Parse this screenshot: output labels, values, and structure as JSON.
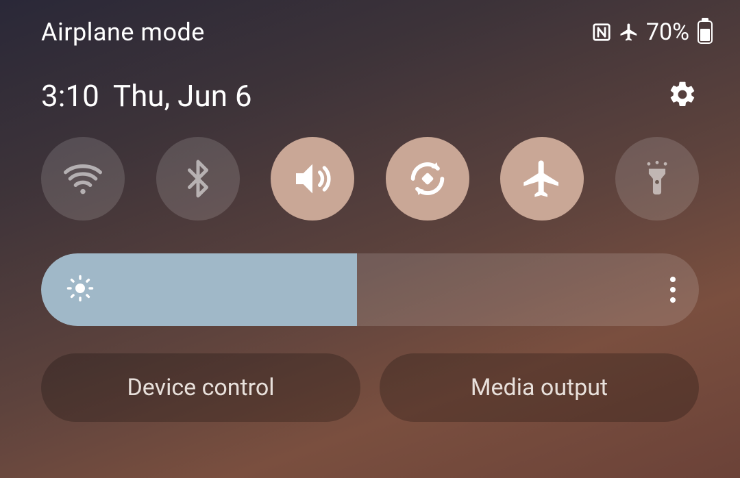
{
  "status": {
    "title": "Airplane mode",
    "battery_percent_label": "70%",
    "battery_fill_percent": 70
  },
  "datetime": {
    "time": "3:10",
    "date": "Thu, Jun 6"
  },
  "toggles": {
    "wifi": {
      "on": false
    },
    "bluetooth": {
      "on": false
    },
    "sound": {
      "on": true
    },
    "rotate": {
      "on": true
    },
    "airplane": {
      "on": true
    },
    "flashlight": {
      "on": false
    }
  },
  "brightness": {
    "percent": 48
  },
  "bottom": {
    "device_control_label": "Device control",
    "media_output_label": "Media output"
  }
}
